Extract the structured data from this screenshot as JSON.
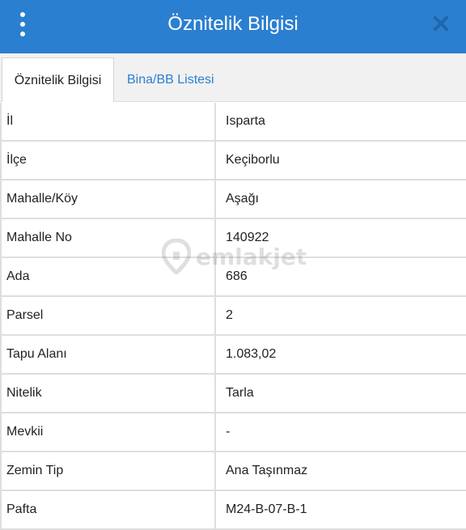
{
  "header": {
    "title": "Öznitelik Bilgisi",
    "menu_icon": "more-vertical-icon",
    "close_icon": "close-icon",
    "color": "#2b7fd0"
  },
  "tabs": [
    {
      "label": "Öznitelik Bilgisi",
      "active": true
    },
    {
      "label": "Bina/BB Listesi",
      "active": false
    }
  ],
  "rows": [
    {
      "key": "İl",
      "value": "Isparta"
    },
    {
      "key": "İlçe",
      "value": "Keçiborlu"
    },
    {
      "key": "Mahalle/Köy",
      "value": "Aşağı"
    },
    {
      "key": "Mahalle No",
      "value": "140922"
    },
    {
      "key": "Ada",
      "value": "686"
    },
    {
      "key": "Parsel",
      "value": "2"
    },
    {
      "key": "Tapu Alanı",
      "value": "1.083,02"
    },
    {
      "key": "Nitelik",
      "value": "Tarla"
    },
    {
      "key": "Mevkii",
      "value": "-"
    },
    {
      "key": "Zemin Tip",
      "value": "Ana Taşınmaz"
    },
    {
      "key": "Pafta",
      "value": "M24-B-07-B-1"
    }
  ],
  "watermark": {
    "text": "emlakjet",
    "icon": "location-pin-icon"
  }
}
